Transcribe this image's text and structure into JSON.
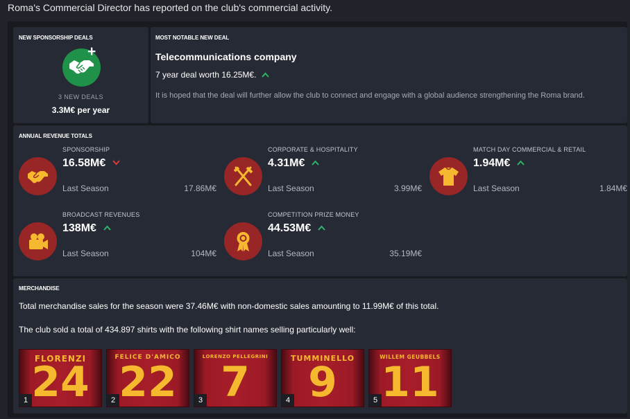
{
  "headline": "Roma's Commercial Director has reported on the club's commercial activity.",
  "new_deals": {
    "section_title": "NEW SPONSORSHIP DEALS",
    "icon": "handshake-plus-icon",
    "count_label": "3 NEW DEALS",
    "per_year": "3.3M€ per year"
  },
  "notable_deal": {
    "section_title": "MOST NOTABLE NEW DEAL",
    "company": "Telecommunications company",
    "deal": "7 year deal worth 16.25M€.",
    "trend": "up",
    "description": "It is hoped that the deal will further allow the club to connect and engage with a global audience strengthening the Roma brand."
  },
  "revenue": {
    "section_title": "ANNUAL REVENUE TOTALS",
    "last_season_label": "Last Season",
    "items": [
      {
        "label": "SPONSORSHIP",
        "value": "16.58M€",
        "trend": "down",
        "last_season": "17.86M€",
        "icon": "handshake-icon"
      },
      {
        "label": "CORPORATE & HOSPITALITY",
        "value": "4.31M€",
        "trend": "up",
        "last_season": "3.99M€",
        "icon": "cutlery-icon"
      },
      {
        "label": "MATCH DAY COMMERCIAL & RETAIL",
        "value": "1.94M€",
        "trend": "up",
        "last_season": "1.84M€",
        "icon": "shirt-icon"
      },
      {
        "label": "BROADCAST REVENUES",
        "value": "138M€",
        "trend": "up",
        "last_season": "104M€",
        "icon": "camera-icon"
      },
      {
        "label": "COMPETITION PRIZE MONEY",
        "value": "44.53M€",
        "trend": "up",
        "last_season": "35.19M€",
        "icon": "medal-icon"
      }
    ]
  },
  "merchandise": {
    "section_title": "MERCHANDISE",
    "sales_text": "Total merchandise sales for the season were 37.46M€ with non-domestic sales amounting to 11.99M€ of this total.",
    "shirts_text": "The club sold a total of 434.897 shirts with the following shirt names selling particularly well:",
    "shirts": [
      {
        "rank": "1",
        "name": "FLORENZI",
        "number": "24"
      },
      {
        "rank": "2",
        "name": "FELICE D'AMICO",
        "number": "22"
      },
      {
        "rank": "3",
        "name": "LORENZO PELLEGRINI",
        "number": "7"
      },
      {
        "rank": "4",
        "name": "TUMMINELLO",
        "number": "9"
      },
      {
        "rank": "5",
        "name": "WILLEM GEUBBELS",
        "number": "11"
      }
    ]
  },
  "colors": {
    "up": "#2fb56a",
    "down": "#d83a3a",
    "icon_red": "#992626",
    "deal_green": "#1f9148",
    "shirt_gold": "#f5b82e"
  }
}
